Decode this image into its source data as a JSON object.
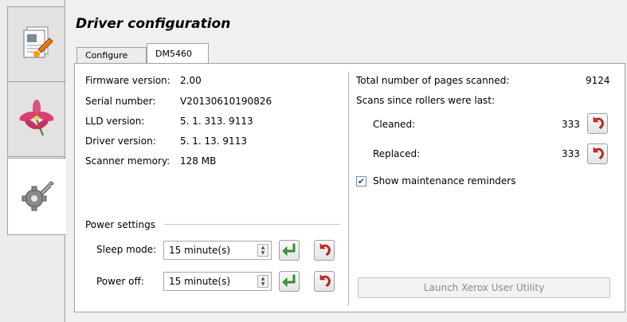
{
  "page_title": "Driver configuration",
  "tabs": [
    {
      "label": "Configure"
    },
    {
      "label": "DM5460"
    }
  ],
  "side_tabs": [
    {
      "icon": "document-edit-icon"
    },
    {
      "icon": "lily-flower-icon"
    },
    {
      "icon": "gear-wrench-icon"
    }
  ],
  "info": {
    "firmware_label": "Firmware version:",
    "firmware_value": "2.00",
    "serial_label": "Serial number:",
    "serial_value": "V20130610190826",
    "lld_label": "LLD version:",
    "lld_value": "5. 1. 313. 9113",
    "driver_label": "Driver version:",
    "driver_value": "5. 1. 13. 9113",
    "memory_label": "Scanner memory:",
    "memory_value": "128 MB"
  },
  "power": {
    "group_label": "Power settings",
    "sleep_label": "Sleep mode:",
    "sleep_value": "15 minute(s)",
    "off_label": "Power off:",
    "off_value": "15 minute(s)"
  },
  "stats": {
    "total_label": "Total number of pages scanned:",
    "total_value": "9124",
    "rollers_label": "Scans since rollers were last:",
    "cleaned_label": "Cleaned:",
    "cleaned_value": "333",
    "replaced_label": "Replaced:",
    "replaced_value": "333"
  },
  "reminder_label": "Show maintenance reminders",
  "reminder_checked": true,
  "launch_label": "Launch Xerox User Utility",
  "colors": {
    "accent_green": "#3fa33a",
    "reset_red": "#d42a1e"
  }
}
